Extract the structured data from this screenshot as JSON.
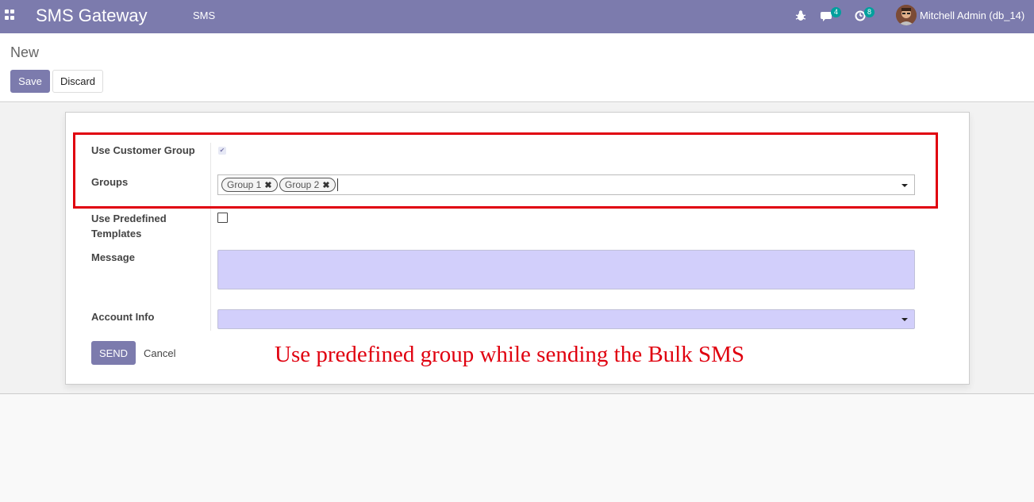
{
  "navbar": {
    "apps_icon": "apps-grid-icon",
    "app_title": "SMS Gateway",
    "menu_item": "SMS",
    "bug_icon": "bug-icon",
    "messages_icon": "chat-icon",
    "messages_badge": "4",
    "activities_icon": "clock-icon",
    "activities_badge": "8",
    "user_name": "Mitchell Admin (db_14)",
    "bar_color": "#7c7bad"
  },
  "control_panel": {
    "breadcrumb": "New",
    "save_label": "Save",
    "discard_label": "Discard"
  },
  "form": {
    "use_customer_group": {
      "label": "Use Customer Group",
      "checked": true
    },
    "groups": {
      "label": "Groups",
      "tags": [
        "Group 1",
        "Group 2"
      ],
      "remove_icon": "close-icon"
    },
    "use_predefined_templates": {
      "label_line1": "Use Predefined",
      "label_line2": "Templates",
      "checked": false
    },
    "message": {
      "label": "Message",
      "value": ""
    },
    "account_info": {
      "label": "Account Info",
      "value": ""
    },
    "send_label": "SEND",
    "cancel_label": "Cancel",
    "required_field_color": "#d2cffb"
  },
  "annotation": {
    "text": "Use predefined group while sending the Bulk SMS",
    "color": "#e0000f"
  }
}
